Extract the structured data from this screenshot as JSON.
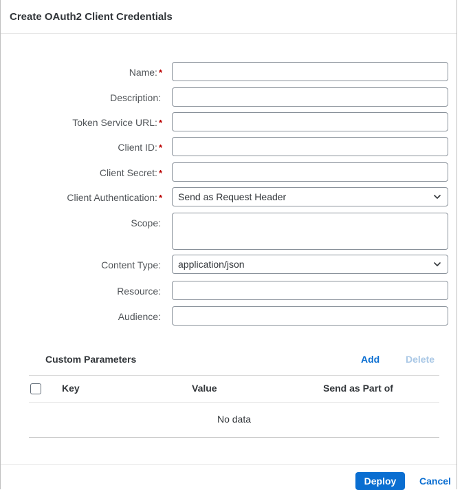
{
  "dialog": {
    "title": "Create OAuth2 Client Credentials"
  },
  "fields": {
    "name": {
      "label": "Name:",
      "value": "",
      "required": true
    },
    "description": {
      "label": "Description:",
      "value": "",
      "required": false
    },
    "token_service_url": {
      "label": "Token Service URL:",
      "value": "",
      "required": true
    },
    "client_id": {
      "label": "Client ID:",
      "value": "",
      "required": true
    },
    "client_secret": {
      "label": "Client Secret:",
      "value": "",
      "required": true
    },
    "client_authentication": {
      "label": "Client Authentication:",
      "value": "Send as Request Header",
      "required": true
    },
    "scope": {
      "label": "Scope:",
      "value": "",
      "required": false
    },
    "content_type": {
      "label": "Content Type:",
      "value": "application/json",
      "required": false
    },
    "resource": {
      "label": "Resource:",
      "value": "",
      "required": false
    },
    "audience": {
      "label": "Audience:",
      "value": "",
      "required": false
    }
  },
  "required_marker": "*",
  "custom_parameters": {
    "title": "Custom Parameters",
    "add_label": "Add",
    "delete_label": "Delete",
    "columns": [
      "Key",
      "Value",
      "Send as Part of"
    ],
    "empty_text": "No data"
  },
  "footer": {
    "deploy_label": "Deploy",
    "cancel_label": "Cancel"
  },
  "colors": {
    "accent": "#0a6ed1",
    "required": "#bb0000",
    "disabled_link": "#aac8e6"
  },
  "icons": {
    "dropdown": "chevron-down-icon",
    "select_all": "checkbox-icon"
  }
}
